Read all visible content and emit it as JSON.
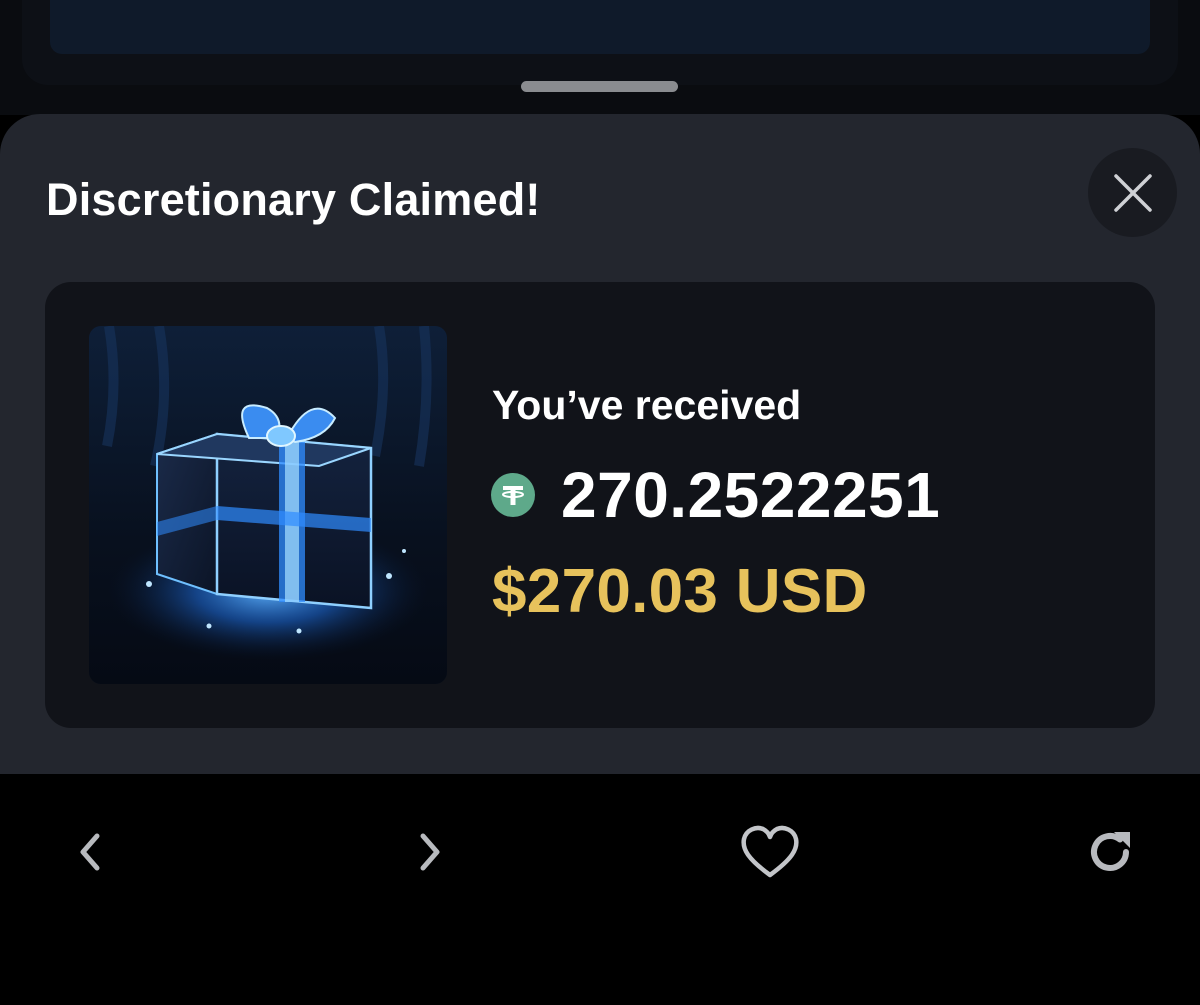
{
  "sheet": {
    "title": "Discretionary Claimed!",
    "close_icon": "close-icon"
  },
  "reward": {
    "image_icon": "gift-box-image",
    "received_label": "You’ve received",
    "token_icon": "tether-usdt-icon",
    "token_amount": "270.2522251",
    "usd_amount": "$270.03 USD"
  },
  "toolbar": {
    "back_icon": "chevron-left-icon",
    "forward_icon": "chevron-right-icon",
    "favorite_icon": "heart-icon",
    "reload_icon": "reload-icon"
  },
  "colors": {
    "sheet_background": "#23262e",
    "card_background": "#111319",
    "usd_amount": "#e7c25c",
    "token_icon": "#5ea98a"
  }
}
